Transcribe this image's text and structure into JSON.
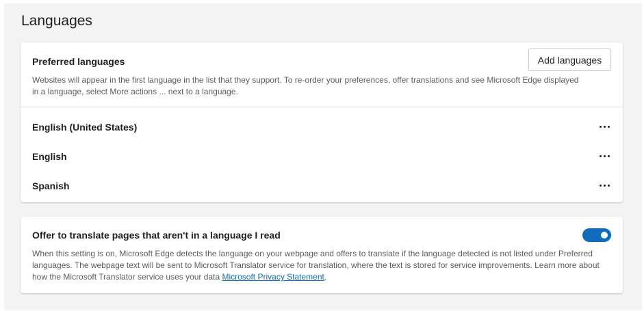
{
  "page": {
    "title": "Languages"
  },
  "preferred": {
    "title": "Preferred languages",
    "description": "Websites will appear in the first language in the list that they support. To re-order your preferences, offer translations and see Microsoft Edge displayed in a language, select More actions ... next to a language.",
    "add_button": "Add languages",
    "languages": [
      {
        "label": "English (United States)",
        "more_icon": "more-actions-icon"
      },
      {
        "label": "English",
        "more_icon": "more-actions-icon"
      },
      {
        "label": "Spanish",
        "more_icon": "more-actions-icon"
      }
    ]
  },
  "translate": {
    "title": "Offer to translate pages that aren't in a language I read",
    "description": "When this setting is on, Microsoft Edge detects the language on your webpage and offers to translate if the language detected is not listed under Preferred languages. The webpage text will be sent to Microsoft Translator service for translation, where the text is stored for service improvements. Learn more about how the Microsoft Translator service uses your data",
    "link_text": "Microsoft Privacy Statement",
    "after_link": ".",
    "toggle_on": true
  },
  "colors": {
    "accent": "#0f6cbd",
    "background": "#f3f3f3",
    "card": "#ffffff"
  }
}
